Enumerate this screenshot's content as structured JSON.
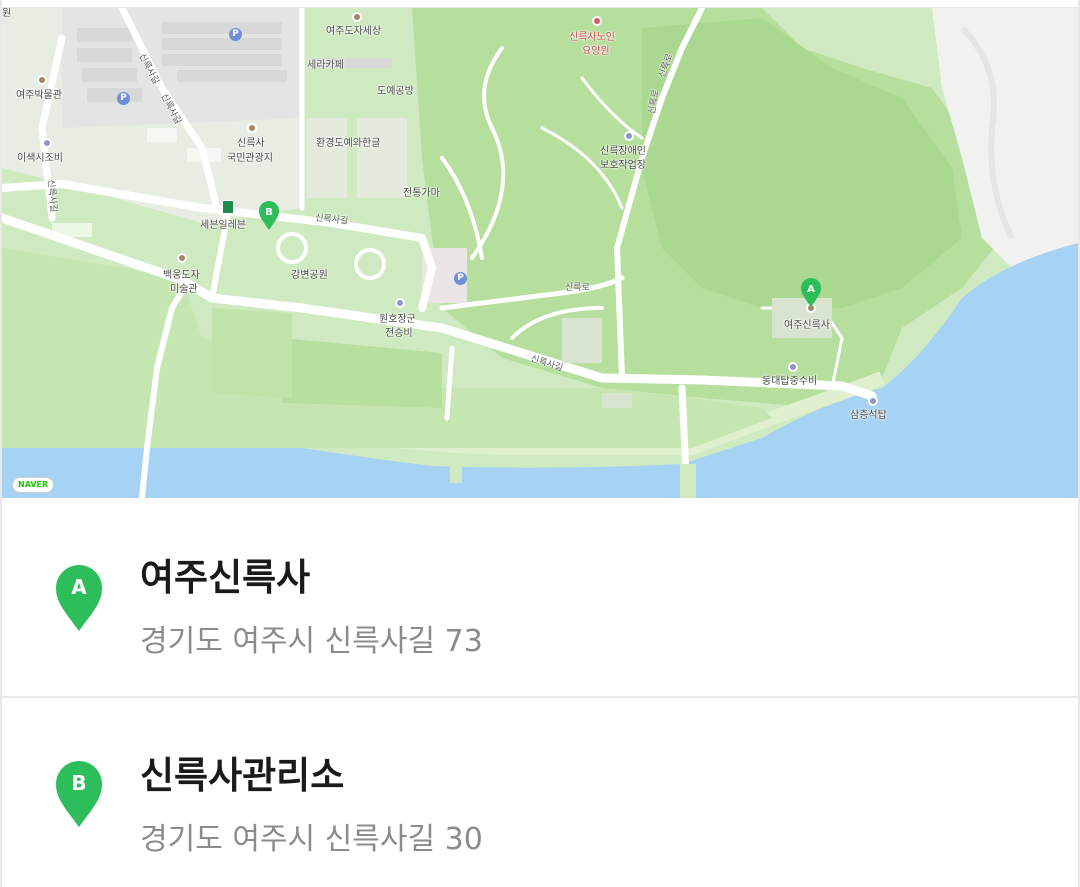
{
  "map": {
    "logo": "NAVER",
    "labels": {
      "yeoju_museum": "여주박물관",
      "yeoju_dojasesang": "여주도자세상",
      "sella_cafe": "세라카페",
      "dogong_bang": "도예공방",
      "silleuksa_nursing": "신륵사노인",
      "silleuksa_nursing2": "요양원",
      "silleuksa_tourist1": "신륵사",
      "silleuksa_tourist2": "국민관광지",
      "hwangyeong": "환경도예와한글",
      "jeontong_gama": "전통가마",
      "yisaek_monument": "이색시조비",
      "seven_eleven": "세븐일레븐",
      "baekun1": "백웅도자",
      "baekun2": "미술관",
      "gangbyeon_park": "강변공원",
      "wonho1": "원호장군",
      "wonho2": "전승비",
      "disabled1": "신륵장애인",
      "disabled2": "보호작업장",
      "yeoju_silleuksa": "여주신륵사",
      "dongdae_tap": "동대탑중수비",
      "samcheung_tap": "삼층석탑",
      "top_left_partial": "원",
      "road_silleuksa_gil_a": "신륵사길",
      "road_silleuksa_gil_b": "신륵사길",
      "road_silleuksa_gil_c": "신륵사길",
      "road_silleuksa_gil_d": "신륵사길",
      "road_silleuksa_gil_e": "신륵사길",
      "road_silleuk_ro_a": "신륵로",
      "road_silleuk_ro_b": "신륵로",
      "road_silleuk_ro_c": "신륵로"
    },
    "pin_a_letter": "A",
    "pin_b_letter": "B",
    "parking_letter": "P"
  },
  "places": [
    {
      "letter": "A",
      "name": "여주신륵사",
      "address": "경기도 여주시 신륵사길 73"
    },
    {
      "letter": "B",
      "name": "신륵사관리소",
      "address": "경기도 여주시 신륵사길 30"
    }
  ],
  "colors": {
    "pin_green": "#2dbe5b",
    "water": "#a6d2f4",
    "park": "#cfeac0"
  }
}
